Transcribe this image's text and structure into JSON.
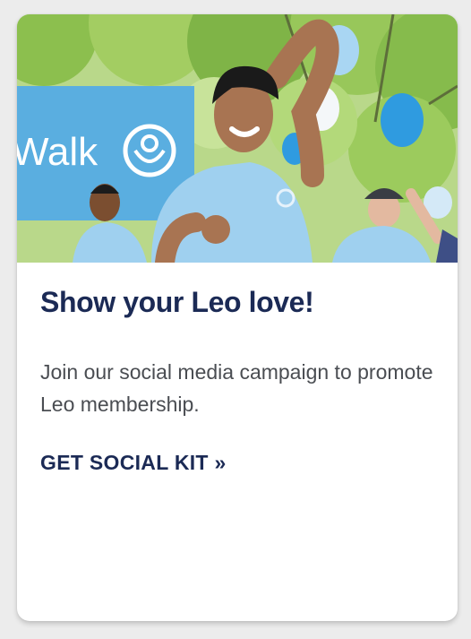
{
  "card": {
    "image": {
      "banner_text": "Walk",
      "banner_icon": "lions-logo-icon"
    },
    "title": "Show your Leo love!",
    "description": "Join our social media campaign to promote Leo membership.",
    "cta_label": "GET SOCIAL KIT »"
  },
  "colors": {
    "title": "#1b2a55",
    "body_text": "#4a4d52",
    "banner": "#5aaee0",
    "shirt": "#9fd0ef",
    "balloon": "#2f9be0"
  }
}
